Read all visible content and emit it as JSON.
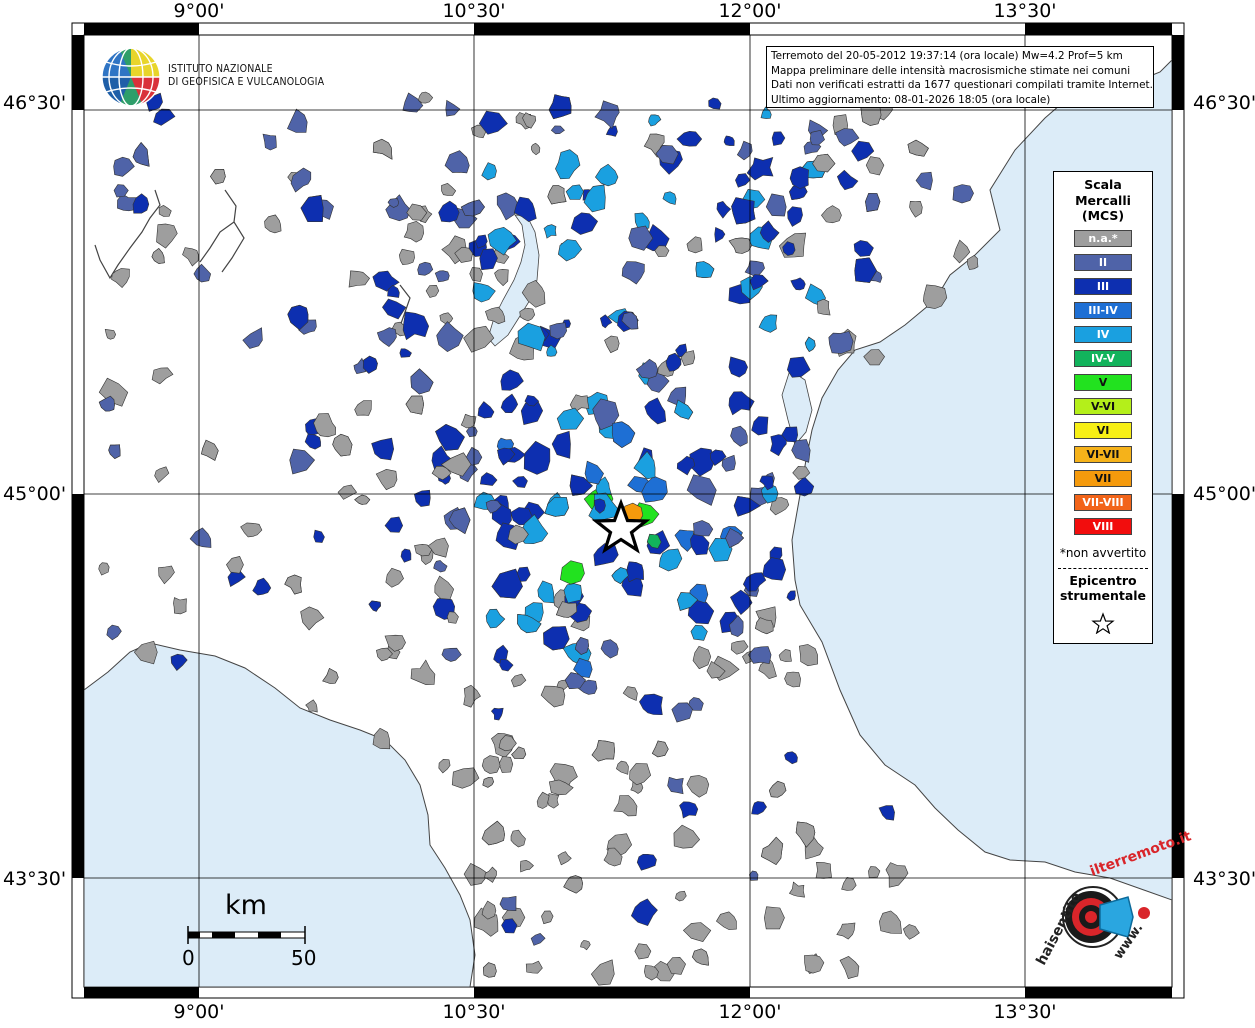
{
  "map": {
    "title_lines": [
      "Terremoto del 20-05-2012 19:37:14 (ora locale) Mw=4.2 Prof=5 km",
      "Mappa preliminare delle intensità macrosismiche stimate nei comuni",
      "Dati non verificati estratti da 1677 questionari compilati tramite Internet.",
      "Ultimo aggiornamento: 08-01-2026 18:05 (ora locale)"
    ],
    "institute": {
      "line1": "ISTITUTO NAZIONALE",
      "line2": "DI GEOFISICA E VULCANOLOGIA"
    },
    "graticule": {
      "lon_labels": [
        "9°00'",
        "10°30'",
        "12°00'",
        "13°30'"
      ],
      "lat_labels": [
        "46°30'",
        "45°00'",
        "43°30'"
      ]
    },
    "legend": {
      "title_lines": [
        "Scala",
        "Mercalli",
        "(MCS)"
      ],
      "items": [
        {
          "label": "n.a.*",
          "color": "#9e9e9e"
        },
        {
          "label": "II",
          "color": "#4f63a8"
        },
        {
          "label": "III",
          "color": "#0d2fb0"
        },
        {
          "label": "III-IV",
          "color": "#1e6fd4"
        },
        {
          "label": "IV",
          "color": "#1aa0e0"
        },
        {
          "label": "IV-V",
          "color": "#12b35c"
        },
        {
          "label": "V",
          "color": "#22e21f"
        },
        {
          "label": "V-VI",
          "color": "#b4ef1a"
        },
        {
          "label": "VI",
          "color": "#f7ef15"
        },
        {
          "label": "VI-VII",
          "color": "#f5b21a"
        },
        {
          "label": "VII",
          "color": "#f59a0c"
        },
        {
          "label": "VII-VIII",
          "color": "#f26419"
        },
        {
          "label": "VIII",
          "color": "#f20d0d"
        }
      ],
      "note": "*non avvertito",
      "epicenter_lines": [
        "Epicentro",
        "strumentale"
      ],
      "epicenter_symbol": "☆"
    },
    "scale_bar": {
      "unit": "km",
      "start": "0",
      "end": "50"
    },
    "site": {
      "text": "haisentito",
      "accent": "ilterremoto.it",
      "www": "www."
    },
    "colors": {
      "sea": "#dcecf8",
      "frame": "#000000",
      "na": "#9e9e9e"
    }
  }
}
